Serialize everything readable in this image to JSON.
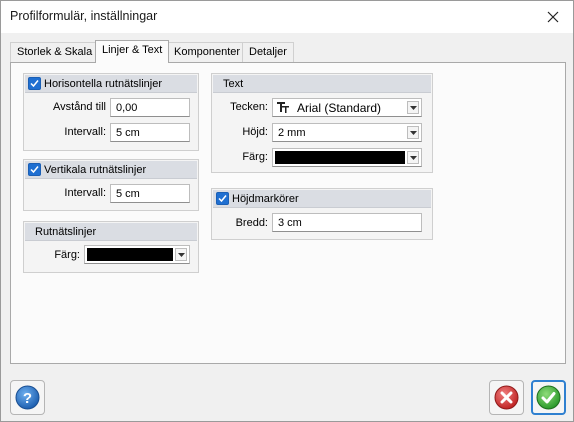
{
  "window": {
    "title": "Profilformulär, inställningar"
  },
  "tabs": [
    {
      "label": "Storlek & Skala",
      "active": false
    },
    {
      "label": "Linjer & Text",
      "active": true
    },
    {
      "label": "Komponenter",
      "active": false
    },
    {
      "label": "Detaljer",
      "active": false
    }
  ],
  "horizontal_grid": {
    "title": "Horisontella rutnätslinjer",
    "checked": true,
    "distance_label": "Avstånd till",
    "distance_value": "0,00",
    "interval_label": "Intervall:",
    "interval_value": "5 cm"
  },
  "vertical_grid": {
    "title": "Vertikala rutnätslinjer",
    "checked": true,
    "interval_label": "Intervall:",
    "interval_value": "5 cm"
  },
  "grid_lines": {
    "title": "Rutnätslinjer",
    "color_label": "Färg:",
    "color": "#000000"
  },
  "text": {
    "title": "Text",
    "font_label": "Tecken:",
    "font_value": "Arial (Standard)",
    "font_icon": "truetype-font-icon",
    "height_label": "Höjd:",
    "height_value": "2 mm",
    "color_label": "Färg:",
    "color": "#000000"
  },
  "height_markers": {
    "title": "Höjdmarkörer",
    "checked": true,
    "width_label": "Bredd:",
    "width_value": "3 cm"
  },
  "footer": {
    "help_icon": "help-icon",
    "cancel_icon": "cancel-icon",
    "ok_icon": "ok-icon"
  },
  "colors": {
    "accent": "#1f6fd1",
    "group_header": "#dadde3",
    "cancel_red": "#d03a3a",
    "ok_green": "#3aa83a"
  }
}
